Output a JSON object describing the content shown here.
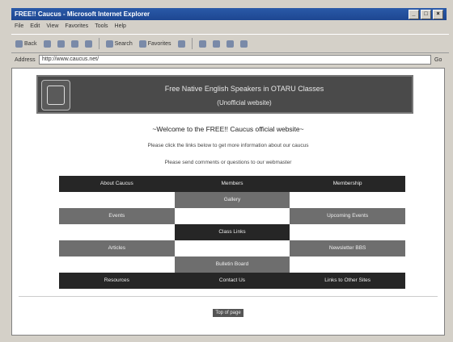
{
  "window": {
    "title": "FREE!! Caucus - Microsoft Internet Explorer"
  },
  "menu": [
    "File",
    "Edit",
    "View",
    "Favorites",
    "Tools",
    "Help"
  ],
  "toolbar": {
    "back": "Back",
    "search": "Search",
    "favorites": "Favorites",
    "history": "History"
  },
  "address": {
    "label": "Address",
    "url": "http://www.caucus.net/",
    "go": "Go"
  },
  "banner": {
    "line1": "Free Native English Speakers in OTARU Classes",
    "line2": "(Unofficial website)"
  },
  "welcome": "~Welcome to the FREE!! Caucus official website~",
  "notice1": "Please click the links below to get more information about our caucus",
  "notice2": "Please send comments or questions to our webmaster",
  "nav": {
    "row1": [
      "About Caucus",
      "Members",
      "Membership"
    ],
    "row2": "Gallery",
    "row3": [
      "Events",
      "Upcoming Events"
    ],
    "row4": "Class Links",
    "row5": [
      "Articles",
      "Newsletter BBS"
    ],
    "row6": "Bulletin Board",
    "row7": [
      "Resources",
      "Contact Us",
      "Links to Other Sites"
    ]
  },
  "footer": {
    "button": "Top of page"
  }
}
